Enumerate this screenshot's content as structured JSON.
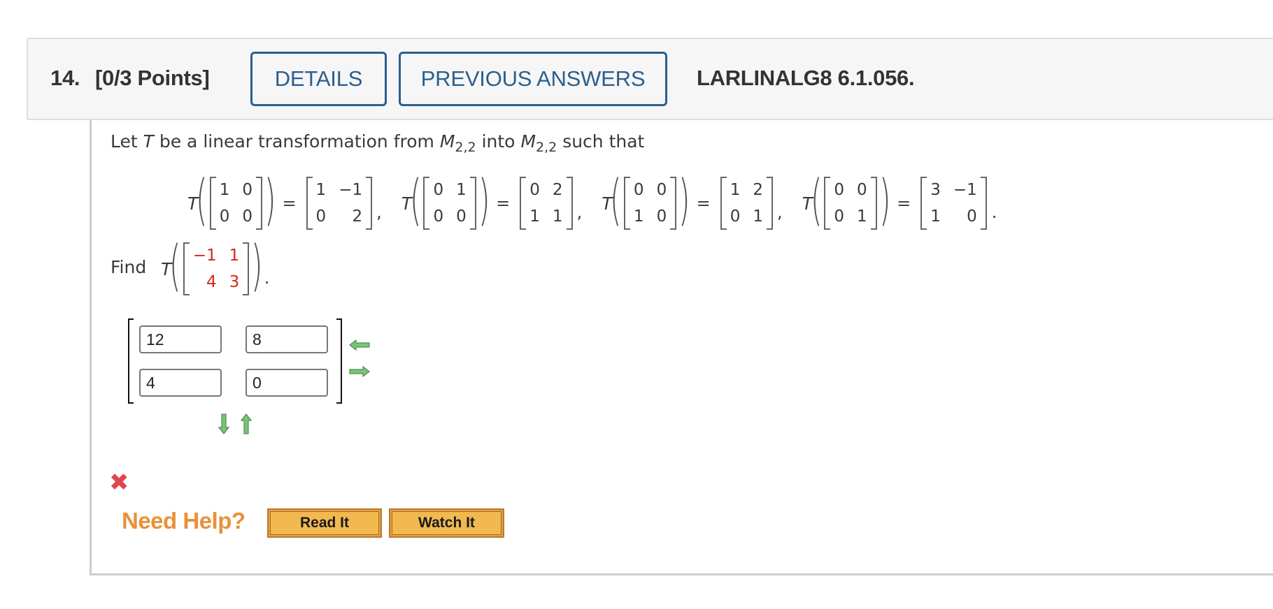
{
  "header": {
    "question_number": "14.",
    "points": "[0/3 Points]",
    "details_label": "DETAILS",
    "previous_answers_label": "PREVIOUS ANSWERS",
    "problem_code": "LARLINALG8 6.1.056."
  },
  "problem": {
    "intro_prefix": "Let",
    "intro_T": "T",
    "intro_mid": "be a linear transformation from",
    "space_M": "M",
    "space_sub": "2,2",
    "intro_into": "into",
    "intro_suffix": "such that",
    "T_symbol": "T",
    "equals": "=",
    "comma": ",",
    "period": ".",
    "mappings": [
      {
        "input": [
          "1",
          "0",
          "0",
          "0"
        ],
        "output": [
          "1",
          "−1",
          "0",
          "2"
        ]
      },
      {
        "input": [
          "0",
          "1",
          "0",
          "0"
        ],
        "output": [
          "0",
          "2",
          "1",
          "1"
        ]
      },
      {
        "input": [
          "0",
          "0",
          "1",
          "0"
        ],
        "output": [
          "1",
          "2",
          "0",
          "1"
        ]
      },
      {
        "input": [
          "0",
          "0",
          "0",
          "1"
        ],
        "output": [
          "3",
          "−1",
          "1",
          "0"
        ]
      }
    ],
    "find_label": "Find",
    "find_matrix": [
      "−1",
      "1",
      "4",
      "3"
    ]
  },
  "answer": {
    "values": [
      "12",
      "8",
      "4",
      "0"
    ],
    "status": "incorrect",
    "status_icon": "x-mark-icon",
    "arrow_icons": [
      "arrow-left-icon",
      "arrow-right-icon",
      "arrow-down-icon",
      "arrow-up-icon"
    ]
  },
  "help": {
    "label": "Need Help?",
    "read_it": "Read It",
    "watch_it": "Watch It"
  },
  "colors": {
    "accent_blue": "#2b5f8e",
    "given_red": "#d4261c",
    "incorrect_red": "#e0474c",
    "help_orange": "#e8913a",
    "help_button": "#f2b950",
    "arrow_green": "#5aa35a"
  }
}
